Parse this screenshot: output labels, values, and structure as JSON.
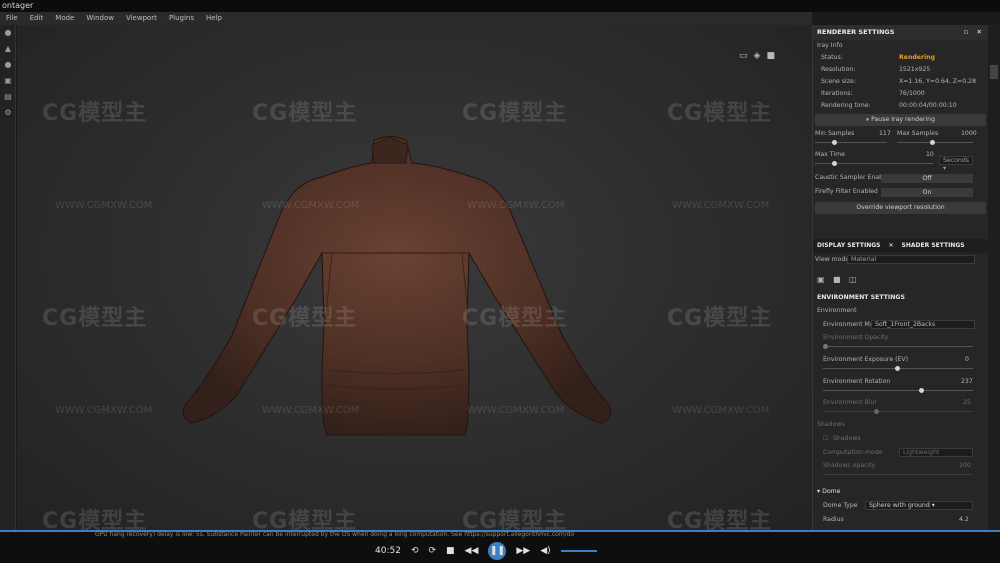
{
  "window": {
    "title": "ontager"
  },
  "menu": [
    "File",
    "Edit",
    "Mode",
    "Window",
    "Viewport",
    "Plugins",
    "Help"
  ],
  "watermark": {
    "logo": "CG模型主",
    "url": "WWW.CGMXW.COM"
  },
  "renderer": {
    "title": "RENDERER SETTINGS",
    "section": "Iray Info",
    "info": [
      {
        "label": "Status:",
        "value": "Rendering"
      },
      {
        "label": "Resolution:",
        "value": "1521x925"
      },
      {
        "label": "Scene size:",
        "value": "X=1.16, Y=0.64, Z=0.28"
      },
      {
        "label": "Iterations:",
        "value": "76/1000"
      },
      {
        "label": "Rendering time:",
        "value": "00:00:04/00:00:10"
      }
    ],
    "pause_label": "Pause Iray rendering",
    "min_samples_label": "Min Samples",
    "min_samples": "117",
    "max_samples_label": "Max Samples",
    "max_samples": "1000",
    "max_time_label": "Max Time",
    "max_time": "10",
    "time_unit": "Seconds",
    "caustic_label": "Caustic Sampler Enabled",
    "caustic_value": "Off",
    "firefly_label": "Firefly Filter Enabled",
    "firefly_value": "On",
    "override_label": "Override viewport resolution",
    "status_color": "#e8a020"
  },
  "display": {
    "tab1": "DISPLAY SETTINGS",
    "tab2": "SHADER SETTINGS",
    "viewmode_label": "View mode",
    "viewmode_value": "Material",
    "env_title": "ENVIRONMENT SETTINGS",
    "env_label": "Environment",
    "env_map_label": "Environment Map",
    "env_map_value": "Soft_1Front_2Backs",
    "env_opacity_label": "Environment Opacity",
    "env_exposure_label": "Environment Exposure (EV)",
    "env_exposure_value": "0",
    "env_rotation_label": "Environment Rotation",
    "env_rotation_value": "237",
    "env_blur_label": "Environment Blur",
    "env_blur_value": "25",
    "shadows_label": "Shadows",
    "shadows_check_label": "Shadows",
    "computation_label": "Computation mode",
    "computation_value": "Lightweight",
    "shadow_opacity_label": "Shadows opacity",
    "shadow_opacity_value": "100",
    "dome_label": "Dome",
    "dome_type_label": "Dome Type",
    "dome_type_value": "Sphere with ground",
    "radius_label": "Radius",
    "radius_value": "4.2"
  },
  "statusbar": {
    "text": "GPU hang recovery) delay is low: 5s. Substance Painter can be interrupted by the OS when doing a long computation. See https://support.allegorithmic.com/do"
  },
  "player": {
    "time": "40:52"
  }
}
